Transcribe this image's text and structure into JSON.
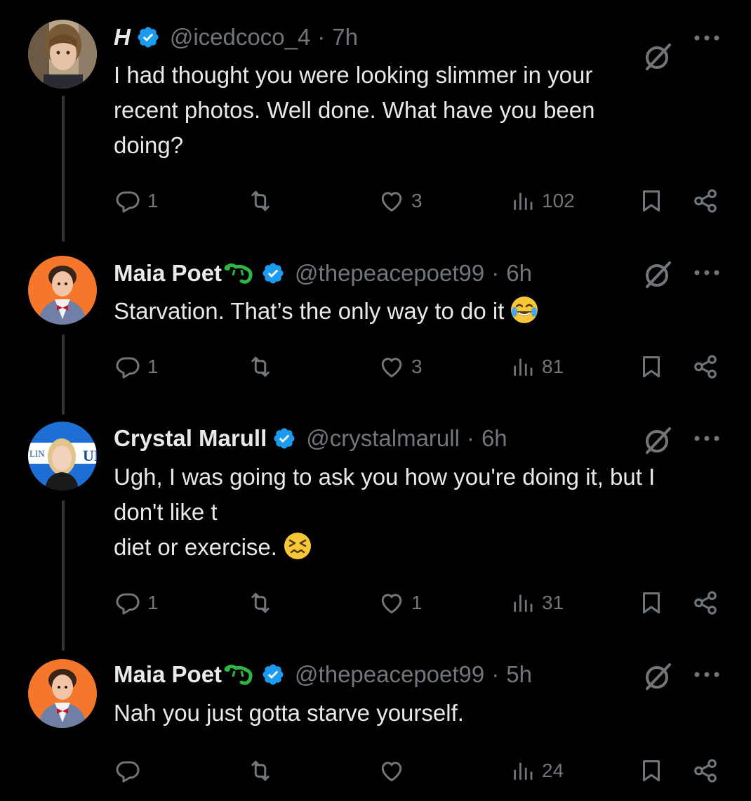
{
  "posts": [
    {
      "name": "H",
      "handle": "@icedcoco_4",
      "separator": "·",
      "time": "7h",
      "text": [
        "I had thought you were looking slimmer in your",
        "recent photos. Well done. What have you been",
        "doing?"
      ],
      "emoji": "",
      "replies": "1",
      "reposts": "",
      "likes": "3",
      "views": "102",
      "has_lizard": false,
      "avatar": "avatar-woman-photo"
    },
    {
      "name": "Maia Poet",
      "handle": "@thepeacepoet99",
      "separator": "·",
      "time": "6h",
      "text": [
        "Starvation. That’s the only way to do it"
      ],
      "emoji": "face-with-tears-of-joy",
      "replies": "1",
      "reposts": "",
      "likes": "3",
      "views": "81",
      "has_lizard": true,
      "avatar": "avatar-bowtie-orange"
    },
    {
      "name": "Crystal Marull",
      "handle": "@crystalmarull",
      "separator": "·",
      "time": "6h",
      "text": [
        "Ugh, I was going to ask you how you're doing it, but I",
        "don't like t",
        "diet or exercise."
      ],
      "emoji": "confounded-face",
      "replies": "1",
      "reposts": "",
      "likes": "1",
      "views": "31",
      "has_lizard": false,
      "avatar": "avatar-woman-blue-logo"
    },
    {
      "name": "Maia Poet",
      "handle": "@thepeacepoet99",
      "separator": "·",
      "time": "5h",
      "text": [
        "Nah you just gotta starve yourself."
      ],
      "emoji": "",
      "replies": "",
      "reposts": "",
      "likes": "",
      "views": "24",
      "has_lizard": true,
      "avatar": "avatar-bowtie-orange"
    }
  ],
  "avatar_text": {
    "logo_left": "LIN",
    "logo_right": "UI"
  },
  "icons": {
    "verified": "verified-badge-icon",
    "grok": "grok-icon",
    "more": "more-icon",
    "reply": "reply-icon",
    "repost": "repost-icon",
    "like": "like-icon",
    "views": "views-icon",
    "bookmark": "bookmark-icon",
    "share": "share-icon"
  },
  "colors": {
    "background": "#000000",
    "text": "#e7e9ea",
    "muted": "#71767b",
    "verified": "#1d9bf0",
    "thread_line": "#333639",
    "lizard": "#2fb344"
  }
}
